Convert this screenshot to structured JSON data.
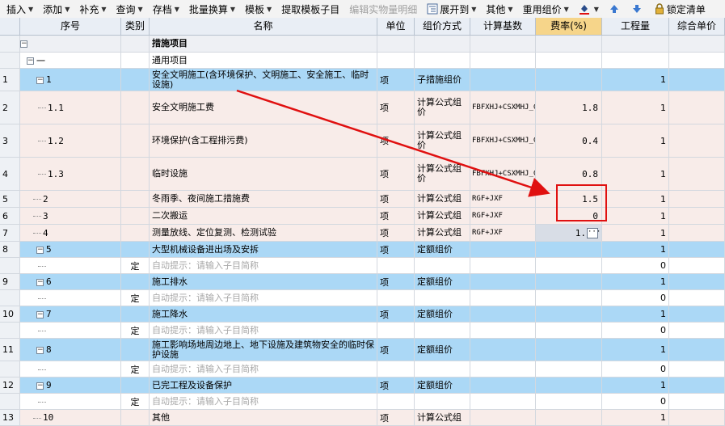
{
  "toolbar": [
    {
      "label": "插入",
      "caret": true
    },
    {
      "label": "添加",
      "caret": true
    },
    {
      "label": "补充",
      "caret": true
    },
    {
      "label": "查询",
      "caret": true
    },
    {
      "label": "存档",
      "caret": true
    },
    {
      "label": "批量换算",
      "caret": true
    },
    {
      "label": "模板",
      "caret": true
    },
    {
      "label": "提取模板子目",
      "caret": false
    },
    {
      "label": "编辑实物量明细",
      "caret": false,
      "disabled": true
    },
    {
      "label": "展开到",
      "caret": true,
      "icon": "expand-icon"
    },
    {
      "label": "其他",
      "caret": true
    },
    {
      "label": "重用组价",
      "caret": true
    },
    {
      "label": "",
      "caret": true,
      "icon": "paint-bucket-icon"
    },
    {
      "label": "",
      "caret": false,
      "icon": "arrow-up-icon"
    },
    {
      "label": "",
      "caret": false,
      "icon": "arrow-down-icon"
    },
    {
      "label": "锁定清单",
      "caret": false,
      "icon": "lock-icon"
    }
  ],
  "columns": [
    "序号",
    "类别",
    "名称",
    "单位",
    "组价方式",
    "计算基数",
    "费率(%)",
    "工程量",
    "综合单价"
  ],
  "rows": [
    {
      "n": "",
      "seq": "",
      "box": "minus",
      "type": "",
      "name": "措施项目",
      "unit": "",
      "method": "",
      "base": "",
      "rate": "",
      "qty": "",
      "bg": "grey",
      "bold": true
    },
    {
      "n": "",
      "seq": "一",
      "box": "minus",
      "type": "",
      "name": "通用项目",
      "unit": "",
      "method": "",
      "base": "",
      "rate": "",
      "qty": "",
      "bg": "white"
    },
    {
      "n": "1",
      "seq": "1",
      "box": "minus",
      "type": "",
      "name": "安全文明施工(含环境保护、文明施工、安全施工、临时设施)",
      "unit": "项",
      "method": "子措施组价",
      "base": "",
      "rate": "",
      "qty": "1",
      "bg": "blue"
    },
    {
      "n": "2",
      "seq": "1.1",
      "type": "",
      "name": "安全文明施工费",
      "unit": "项",
      "method": "计算公式组价",
      "base": "FBFXHJ+CSXMHJ_CCAQWMSG+QTXMHJ",
      "rate": "1.8",
      "qty": "1",
      "bg": "pink"
    },
    {
      "n": "3",
      "seq": "1.2",
      "type": "",
      "name": "环境保护(含工程排污费)",
      "unit": "项",
      "method": "计算公式组价",
      "base": "FBFXHJ+CSXMHJ_CCAQWMSG+QTXMHJ",
      "rate": "0.4",
      "qty": "1",
      "bg": "pink"
    },
    {
      "n": "4",
      "seq": "1.3",
      "type": "",
      "name": "临时设施",
      "unit": "项",
      "method": "计算公式组价",
      "base": "FBFXHJ+CSXMHJ_CCAQWMSG+QTXMHJ",
      "rate": "0.8",
      "qty": "1",
      "bg": "pink"
    },
    {
      "n": "5",
      "seq": "2",
      "type": "",
      "name": "冬雨季、夜间施工措施费",
      "unit": "项",
      "method": "计算公式组",
      "base": "RGF+JXF",
      "rate": "1.5",
      "qty": "1",
      "bg": "pink"
    },
    {
      "n": "6",
      "seq": "3",
      "type": "",
      "name": "二次搬运",
      "unit": "项",
      "method": "计算公式组",
      "base": "RGF+JXF",
      "rate": "0",
      "qty": "1",
      "bg": "pink"
    },
    {
      "n": "7",
      "seq": "4",
      "type": "",
      "name": "测量放线、定位复测、检测试验",
      "unit": "项",
      "method": "计算公式组",
      "base": "RGF+JXF",
      "rate": "1.",
      "qty": "1",
      "bg": "pink",
      "editing": true
    },
    {
      "n": "8",
      "seq": "5",
      "box": "minus",
      "type": "",
      "name": "大型机械设备进出场及安拆",
      "unit": "项",
      "method": "定额组价",
      "base": "",
      "rate": "",
      "qty": "1",
      "bg": "blue"
    },
    {
      "n": "",
      "seq": "",
      "type": "定",
      "name": "自动提示：请输入子目简称",
      "unit": "",
      "method": "",
      "base": "",
      "rate": "",
      "qty": "0",
      "bg": "white",
      "hint": true
    },
    {
      "n": "9",
      "seq": "6",
      "box": "minus",
      "type": "",
      "name": "施工排水",
      "unit": "项",
      "method": "定额组价",
      "base": "",
      "rate": "",
      "qty": "1",
      "bg": "blue"
    },
    {
      "n": "",
      "seq": "",
      "type": "定",
      "name": "自动提示：请输入子目简称",
      "unit": "",
      "method": "",
      "base": "",
      "rate": "",
      "qty": "0",
      "bg": "white",
      "hint": true
    },
    {
      "n": "10",
      "seq": "7",
      "box": "minus",
      "type": "",
      "name": "施工降水",
      "unit": "项",
      "method": "定额组价",
      "base": "",
      "rate": "",
      "qty": "1",
      "bg": "blue"
    },
    {
      "n": "",
      "seq": "",
      "type": "定",
      "name": "自动提示：请输入子目简称",
      "unit": "",
      "method": "",
      "base": "",
      "rate": "",
      "qty": "0",
      "bg": "white",
      "hint": true
    },
    {
      "n": "11",
      "seq": "8",
      "box": "minus",
      "type": "",
      "name": "施工影响场地周边地上、地下设施及建筑物安全的临时保护设施",
      "unit": "项",
      "method": "定额组价",
      "base": "",
      "rate": "",
      "qty": "1",
      "bg": "blue"
    },
    {
      "n": "",
      "seq": "",
      "type": "定",
      "name": "自动提示：请输入子目简称",
      "unit": "",
      "method": "",
      "base": "",
      "rate": "",
      "qty": "0",
      "bg": "white",
      "hint": true
    },
    {
      "n": "12",
      "seq": "9",
      "box": "minus",
      "type": "",
      "name": "已完工程及设备保护",
      "unit": "项",
      "method": "定额组价",
      "base": "",
      "rate": "",
      "qty": "1",
      "bg": "blue"
    },
    {
      "n": "",
      "seq": "",
      "type": "定",
      "name": "自动提示：请输入子目简称",
      "unit": "",
      "method": "",
      "base": "",
      "rate": "",
      "qty": "0",
      "bg": "white",
      "hint": true
    },
    {
      "n": "13",
      "seq": "10",
      "type": "",
      "name": "其他",
      "unit": "项",
      "method": "计算公式组",
      "base": "",
      "rate": "",
      "qty": "1",
      "bg": "pink"
    }
  ],
  "colors": {
    "row_blue": "#abd8f6",
    "row_pink": "#f8ece9",
    "rate_header": "#f6d58a",
    "annotation_red": "#e01010"
  }
}
